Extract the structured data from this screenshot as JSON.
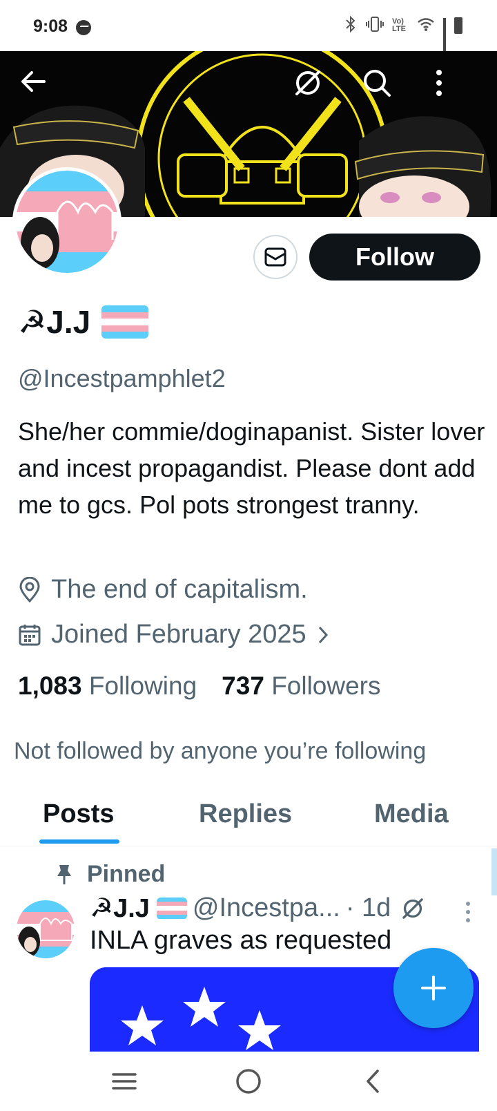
{
  "status_bar": {
    "time": "9:08",
    "icons": [
      "messenger-icon",
      "bluetooth-icon",
      "vibrate-icon",
      "volte-icon",
      "wifi-icon",
      "signal-icon",
      "battery-icon"
    ],
    "volte_label": "Vo) LTE"
  },
  "header": {
    "back_icon": "arrow-left-icon",
    "grok_icon": "grok-icon",
    "search_icon": "search-icon",
    "more_icon": "more-vertical-icon"
  },
  "profile": {
    "display_name": "☭J.J",
    "handle": "@Incestpamphlet2",
    "bio": "She/her commie/doginapanist. Sister lover and incest propagandist. Please dont add me to gcs. Pol pots strongest tranny.",
    "location": "The end of capitalism.",
    "joined": "Joined February 2025",
    "following_count": "1,083",
    "following_label": "Following",
    "followers_count": "737",
    "followers_label": "Followers",
    "not_followed_text": "Not followed by anyone you’re following",
    "follow_label": "Follow"
  },
  "tabs": [
    {
      "label": "Posts",
      "active": true
    },
    {
      "label": "Replies",
      "active": false
    },
    {
      "label": "Media",
      "active": false
    }
  ],
  "pinned_post": {
    "pinned_label": "Pinned",
    "author_name": "☭J.J",
    "author_handle": "@Incestpa...",
    "time": "· 1d",
    "text": "INLA graves as requested"
  },
  "colors": {
    "accent": "#1d9bf0",
    "text_primary": "#0f1419",
    "text_secondary": "#536471",
    "trans_blue": "#5bcefa",
    "trans_pink": "#f5a9b8",
    "banner_yellow": "#f2e21b"
  }
}
